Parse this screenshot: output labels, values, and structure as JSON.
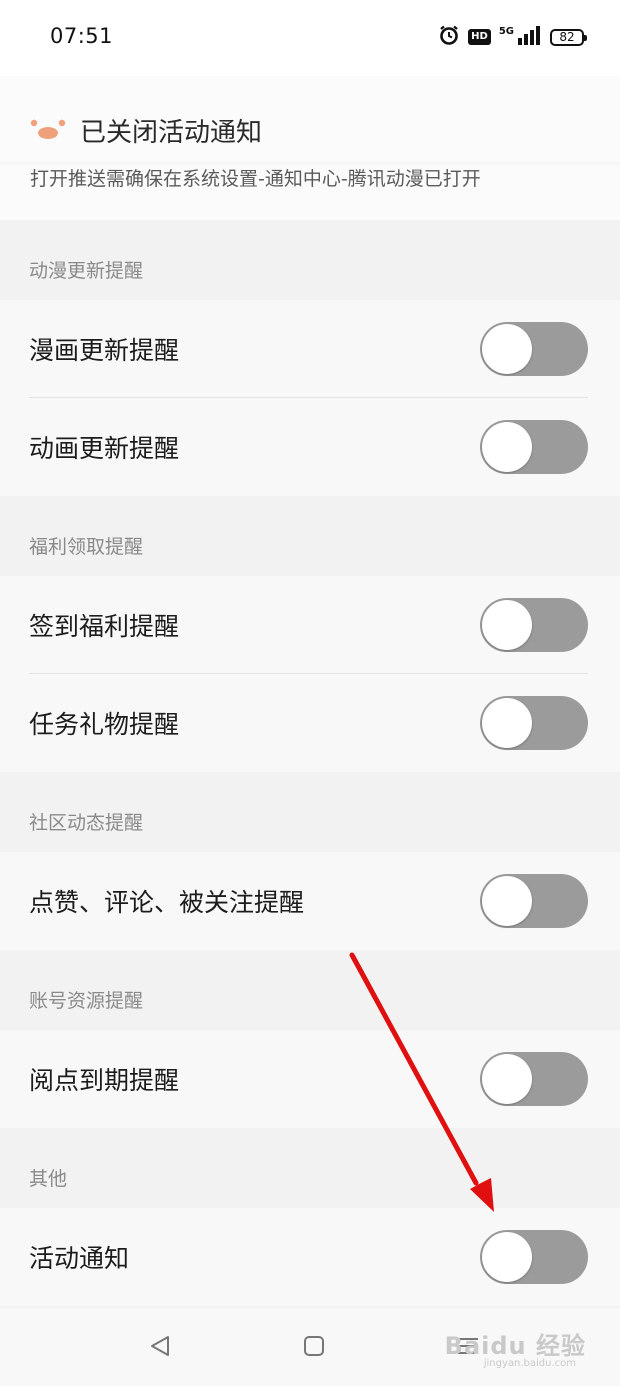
{
  "status": {
    "time": "07:51",
    "hd": "HD",
    "network": "5G",
    "battery": "82"
  },
  "notice": {
    "title": "已关闭活动通知",
    "desc": "打开推送需确保在系统设置-通知中心-腾讯动漫已打开"
  },
  "sections": [
    {
      "title": "动漫更新提醒",
      "items": [
        {
          "label": "漫画更新提醒",
          "on": false
        },
        {
          "label": "动画更新提醒",
          "on": false
        }
      ]
    },
    {
      "title": "福利领取提醒",
      "items": [
        {
          "label": "签到福利提醒",
          "on": false
        },
        {
          "label": "任务礼物提醒",
          "on": false
        }
      ]
    },
    {
      "title": "社区动态提醒",
      "items": [
        {
          "label": "点赞、评论、被关注提醒",
          "on": false
        }
      ]
    },
    {
      "title": "账号资源提醒",
      "items": [
        {
          "label": "阅点到期提醒",
          "on": false
        }
      ]
    },
    {
      "title": "其他",
      "items": [
        {
          "label": "活动通知",
          "on": false
        }
      ]
    }
  ],
  "watermark": {
    "brand": "Baidu 经验",
    "url": "jingyan.baidu.com"
  },
  "colors": {
    "toggle_off": "#9b9b9b",
    "logo": "#f0a07a",
    "arrow": "#e01010"
  },
  "icons": [
    "alarm-icon",
    "signal-icon",
    "battery-icon",
    "back-icon",
    "home-icon",
    "menu-icon"
  ]
}
